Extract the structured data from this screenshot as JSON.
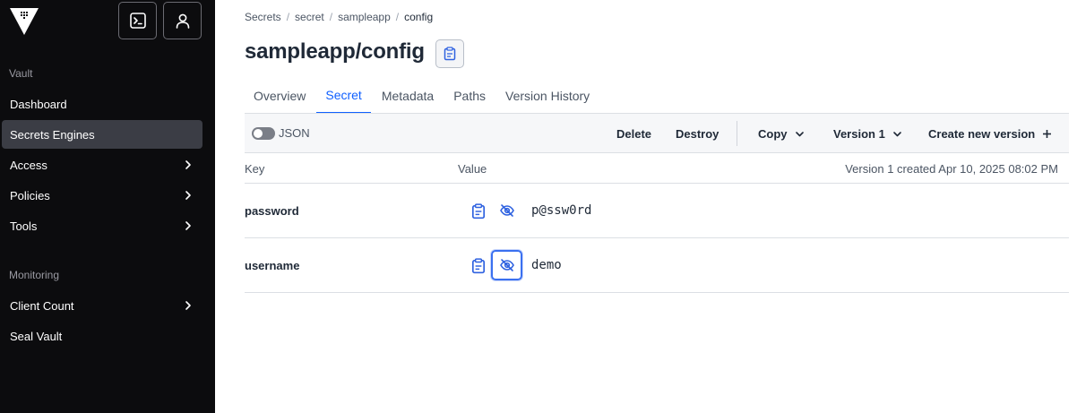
{
  "sidebar": {
    "sections": [
      {
        "label": "Vault",
        "items": [
          {
            "label": "Dashboard",
            "chevron": false,
            "active": false
          },
          {
            "label": "Secrets Engines",
            "chevron": false,
            "active": true
          },
          {
            "label": "Access",
            "chevron": true,
            "active": false
          },
          {
            "label": "Policies",
            "chevron": true,
            "active": false
          },
          {
            "label": "Tools",
            "chevron": true,
            "active": false
          }
        ]
      },
      {
        "label": "Monitoring",
        "items": [
          {
            "label": "Client Count",
            "chevron": true,
            "active": false
          },
          {
            "label": "Seal Vault",
            "chevron": false,
            "active": false
          }
        ]
      }
    ]
  },
  "breadcrumb": [
    "Secrets",
    "secret",
    "sampleapp",
    "config"
  ],
  "page": {
    "title": "sampleapp/config"
  },
  "tabs": [
    {
      "label": "Overview",
      "active": false
    },
    {
      "label": "Secret",
      "active": true
    },
    {
      "label": "Metadata",
      "active": false
    },
    {
      "label": "Paths",
      "active": false
    },
    {
      "label": "Version History",
      "active": false
    }
  ],
  "toolbar": {
    "json_label": "JSON",
    "delete_label": "Delete",
    "destroy_label": "Destroy",
    "copy_label": "Copy",
    "version_label": "Version 1",
    "create_label": "Create new version"
  },
  "table": {
    "key_header": "Key",
    "value_header": "Value",
    "version_info": "Version 1 created Apr 10, 2025 08:02 PM",
    "rows": [
      {
        "key": "password",
        "value": "p@ssw0rd"
      },
      {
        "key": "username",
        "value": "demo"
      }
    ]
  },
  "colors": {
    "accent": "#1060ff",
    "sidebar_bg": "#0c0c0e",
    "sidebar_active": "#3b3d45",
    "icon_blue": "#2f62e0"
  }
}
